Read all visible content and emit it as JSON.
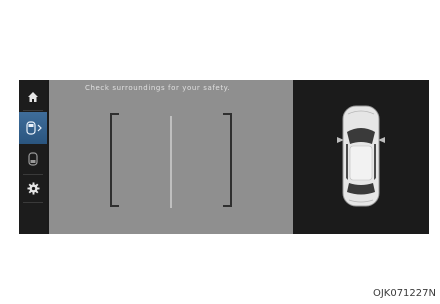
{
  "camera": {
    "warning_text": "Check surroundings for your safety."
  },
  "sidebar": {
    "items": [
      {
        "icon": "home-icon"
      },
      {
        "icon": "rear-camera-view-icon",
        "active": true
      },
      {
        "icon": "front-camera-view-icon"
      },
      {
        "icon": "settings-gear-icon"
      }
    ]
  },
  "figure": {
    "code": "OJK071227N"
  },
  "colors": {
    "active_accent": "#3f6d9a",
    "camera_background": "#8f8f8f",
    "guide_lines": "#2f2f2f"
  }
}
